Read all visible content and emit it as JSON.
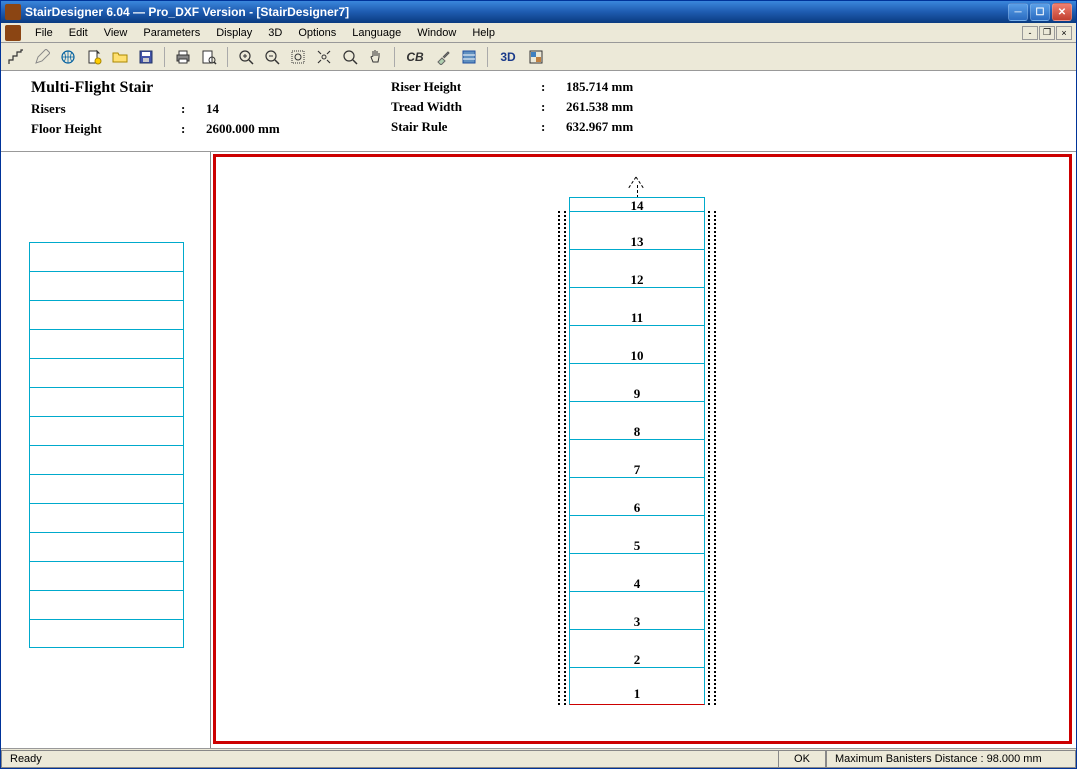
{
  "window": {
    "title": "StairDesigner 6.04 — Pro_DXF Version - [StairDesigner7]"
  },
  "menu": {
    "file": "File",
    "edit": "Edit",
    "view": "View",
    "parameters": "Parameters",
    "display": "Display",
    "threeD": "3D",
    "options": "Options",
    "language": "Language",
    "window": "Window",
    "help": "Help"
  },
  "toolbar": {
    "cb_label": "CB",
    "threeD_label": "3D"
  },
  "info": {
    "title": "Multi-Flight Stair",
    "risers_label": "Risers",
    "risers_value": "14",
    "floor_height_label": "Floor Height",
    "floor_height_value": "2600.000 mm",
    "riser_height_label": "Riser Height",
    "riser_height_value": "185.714 mm",
    "tread_width_label": "Tread Width",
    "tread_width_value": "261.538 mm",
    "stair_rule_label": "Stair Rule",
    "stair_rule_value": "632.967 mm"
  },
  "treads": [
    "14",
    "13",
    "12",
    "11",
    "10",
    "9",
    "8",
    "7",
    "6",
    "5",
    "4",
    "3",
    "2",
    "1"
  ],
  "status": {
    "ready": "Ready",
    "ok": "OK",
    "message": "Maximum Banisters Distance : 98.000 mm"
  }
}
